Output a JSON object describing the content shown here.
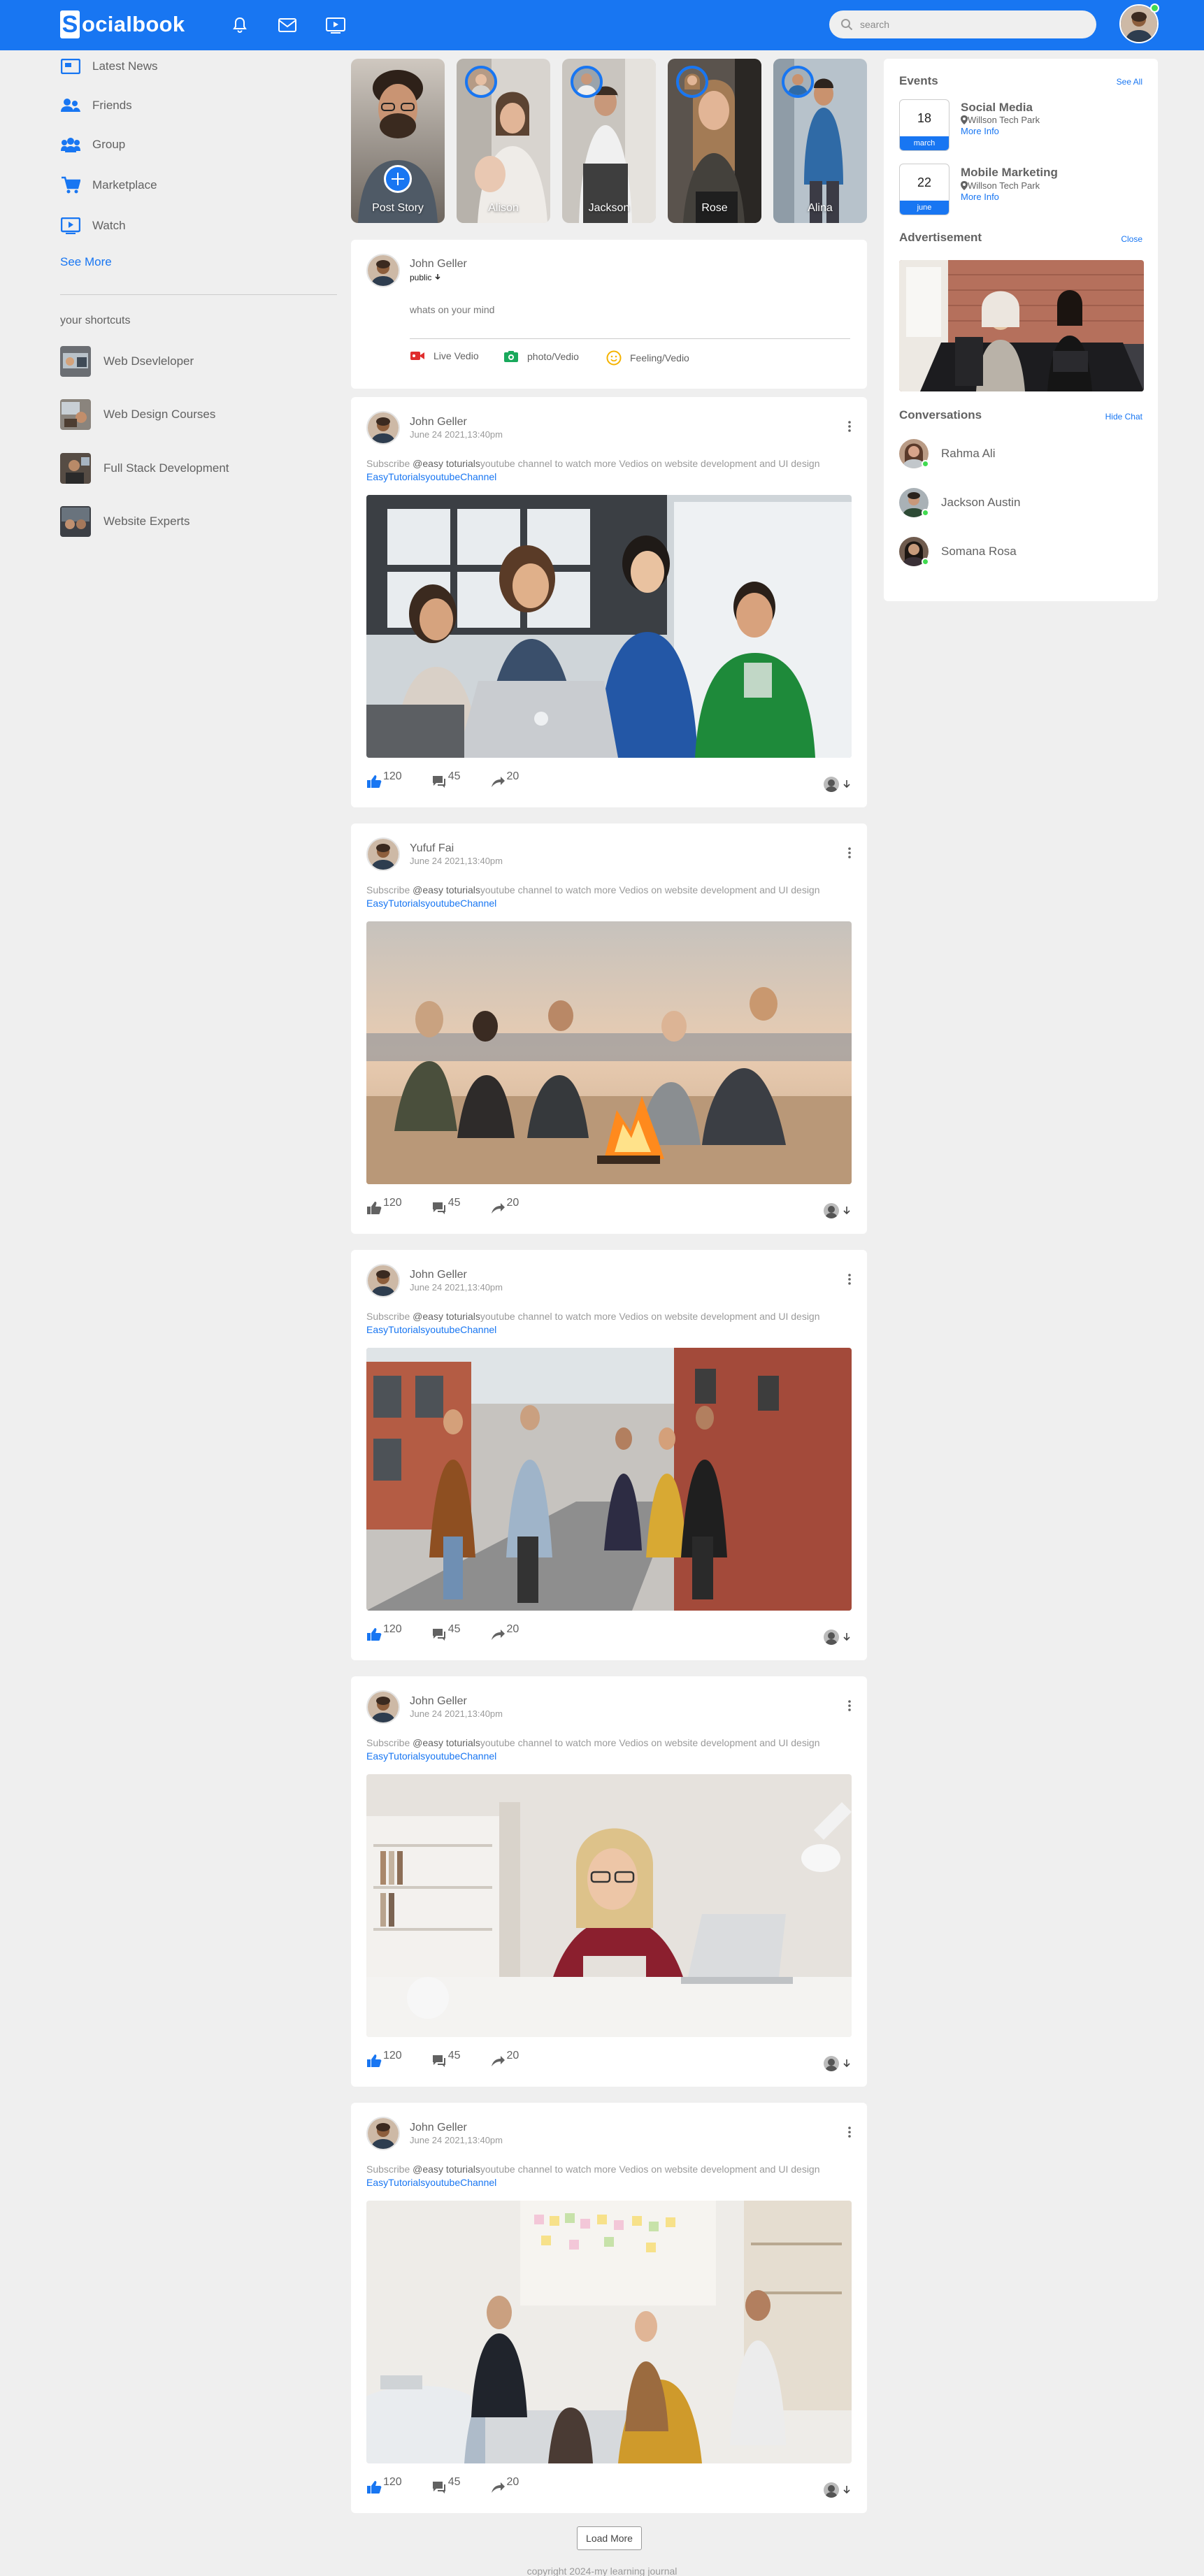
{
  "navbar": {
    "logo_letter": "S",
    "logo_text": "ocialbook",
    "search_placeholder": "search",
    "icons": [
      "bell-icon",
      "mail-icon",
      "video-icon",
      "search-icon"
    ],
    "brand_color": "#1876f2"
  },
  "sidebar": {
    "links": [
      {
        "label": "Latest News",
        "icon": "newspaper-icon"
      },
      {
        "label": "Friends",
        "icon": "friends-icon"
      },
      {
        "label": "Group",
        "icon": "group-icon"
      },
      {
        "label": "Marketplace",
        "icon": "cart-icon"
      },
      {
        "label": "Watch",
        "icon": "play-icon"
      }
    ],
    "see_more": "See More",
    "shortcuts_title": "your shortcuts",
    "shortcuts": [
      {
        "label": "Web Dsevleloper"
      },
      {
        "label": "Web Design Courses"
      },
      {
        "label": "Full Stack Development"
      },
      {
        "label": "Website Experts"
      }
    ]
  },
  "stories": [
    {
      "name": "Post Story"
    },
    {
      "name": "Alison"
    },
    {
      "name": "Jackson"
    },
    {
      "name": "Rose"
    },
    {
      "name": "Alina"
    }
  ],
  "write_post": {
    "author": "John Geller",
    "privacy": "public",
    "placeholder": "whats on your mind",
    "actions": [
      {
        "label": "Live Vedio",
        "icon": "video-camera-icon",
        "color": "#e02e2e"
      },
      {
        "label": "photo/Vedio",
        "icon": "camera-icon",
        "color": "#19a95c"
      },
      {
        "label": "Feeling/Vedio",
        "icon": "smile-icon",
        "color": "#f5b300"
      }
    ]
  },
  "posts": [
    {
      "author": "John Geller",
      "date": "June 24 2021,13:40pm",
      "text_pre": "Subscribe ",
      "text_bold": "@easy toturials",
      "text_mid": "youtube channel to watch more Vedios on website development and UI design ",
      "text_link": "EasyTutorialsyoutubeChannel",
      "likes": "120",
      "comments": "45",
      "shares": "20"
    },
    {
      "author": "Yufuf Fai",
      "date": "June 24 2021,13:40pm",
      "text_pre": "Subscribe ",
      "text_bold": "@easy toturials",
      "text_mid": "youtube channel to watch more Vedios on website development and UI design ",
      "text_link": "EasyTutorialsyoutubeChannel",
      "likes": "120",
      "comments": "45",
      "shares": "20"
    },
    {
      "author": "John Geller",
      "date": "June 24 2021,13:40pm",
      "text_pre": "Subscribe ",
      "text_bold": "@easy toturials",
      "text_mid": "youtube channel to watch more Vedios on website development and UI design ",
      "text_link": "EasyTutorialsyoutubeChannel",
      "likes": "120",
      "comments": "45",
      "shares": "20"
    },
    {
      "author": "John Geller",
      "date": "June 24 2021,13:40pm",
      "text_pre": "Subscribe ",
      "text_bold": "@easy toturials",
      "text_mid": "youtube channel to watch more Vedios on website development and UI design ",
      "text_link": "EasyTutorialsyoutubeChannel",
      "likes": "120",
      "comments": "45",
      "shares": "20"
    },
    {
      "author": "John Geller",
      "date": "June 24 2021,13:40pm",
      "text_pre": "Subscribe ",
      "text_bold": "@easy toturials",
      "text_mid": "youtube channel to watch more Vedios on website development and UI design ",
      "text_link": "EasyTutorialsyoutubeChannel",
      "likes": "120",
      "comments": "45",
      "shares": "20"
    }
  ],
  "right": {
    "events_title": "Events",
    "see_all": "See All",
    "events": [
      {
        "day": "18",
        "month": "march",
        "title": "Social Media",
        "location": "Willson Tech Park",
        "more": "More Info"
      },
      {
        "day": "22",
        "month": "june",
        "title": "Mobile Marketing",
        "location": "Willson Tech Park",
        "more": "More Info"
      }
    ],
    "ad_title": "Advertisement",
    "close": "Close",
    "conversations_title": "Conversations",
    "hide_chat": "Hide Chat",
    "contacts": [
      {
        "name": "Rahma Ali"
      },
      {
        "name": "Jackson Austin"
      },
      {
        "name": "Somana Rosa"
      }
    ]
  },
  "load_more": "Load More",
  "footer": "copyright 2024-my learning journal"
}
